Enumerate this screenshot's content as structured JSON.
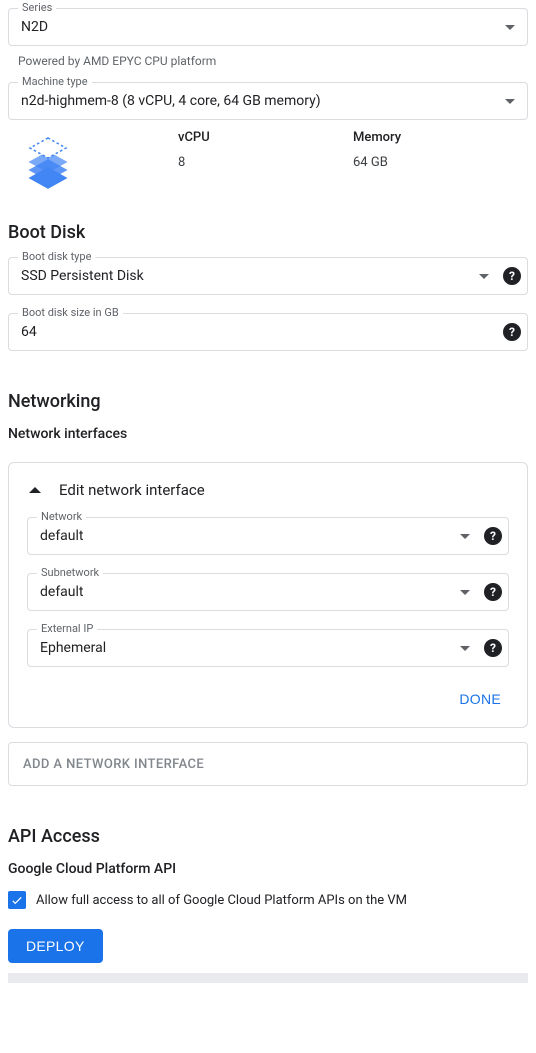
{
  "machine": {
    "series_label": "Series",
    "series_value": "N2D",
    "series_subtext": "Powered by AMD EPYC CPU platform",
    "type_label": "Machine type",
    "type_value": "n2d-highmem-8 (8 vCPU, 4 core, 64 GB memory)",
    "specs": {
      "vcpu_header": "vCPU",
      "vcpu_value": "8",
      "memory_header": "Memory",
      "memory_value": "64 GB"
    }
  },
  "boot_disk": {
    "title": "Boot Disk",
    "type_label": "Boot disk type",
    "type_value": "SSD Persistent Disk",
    "size_label": "Boot disk size in GB",
    "size_value": "64"
  },
  "networking": {
    "title": "Networking",
    "interfaces_label": "Network interfaces",
    "edit_title": "Edit network interface",
    "network_label": "Network",
    "network_value": "default",
    "subnetwork_label": "Subnetwork",
    "subnetwork_value": "default",
    "external_ip_label": "External IP",
    "external_ip_value": "Ephemeral",
    "done_label": "DONE",
    "add_interface_label": "ADD A NETWORK INTERFACE"
  },
  "api": {
    "title": "API Access",
    "subtitle": "Google Cloud Platform API",
    "checkbox_label": "Allow full access to all of Google Cloud Platform APIs on the VM",
    "checked": true
  },
  "actions": {
    "deploy_label": "DEPLOY"
  }
}
